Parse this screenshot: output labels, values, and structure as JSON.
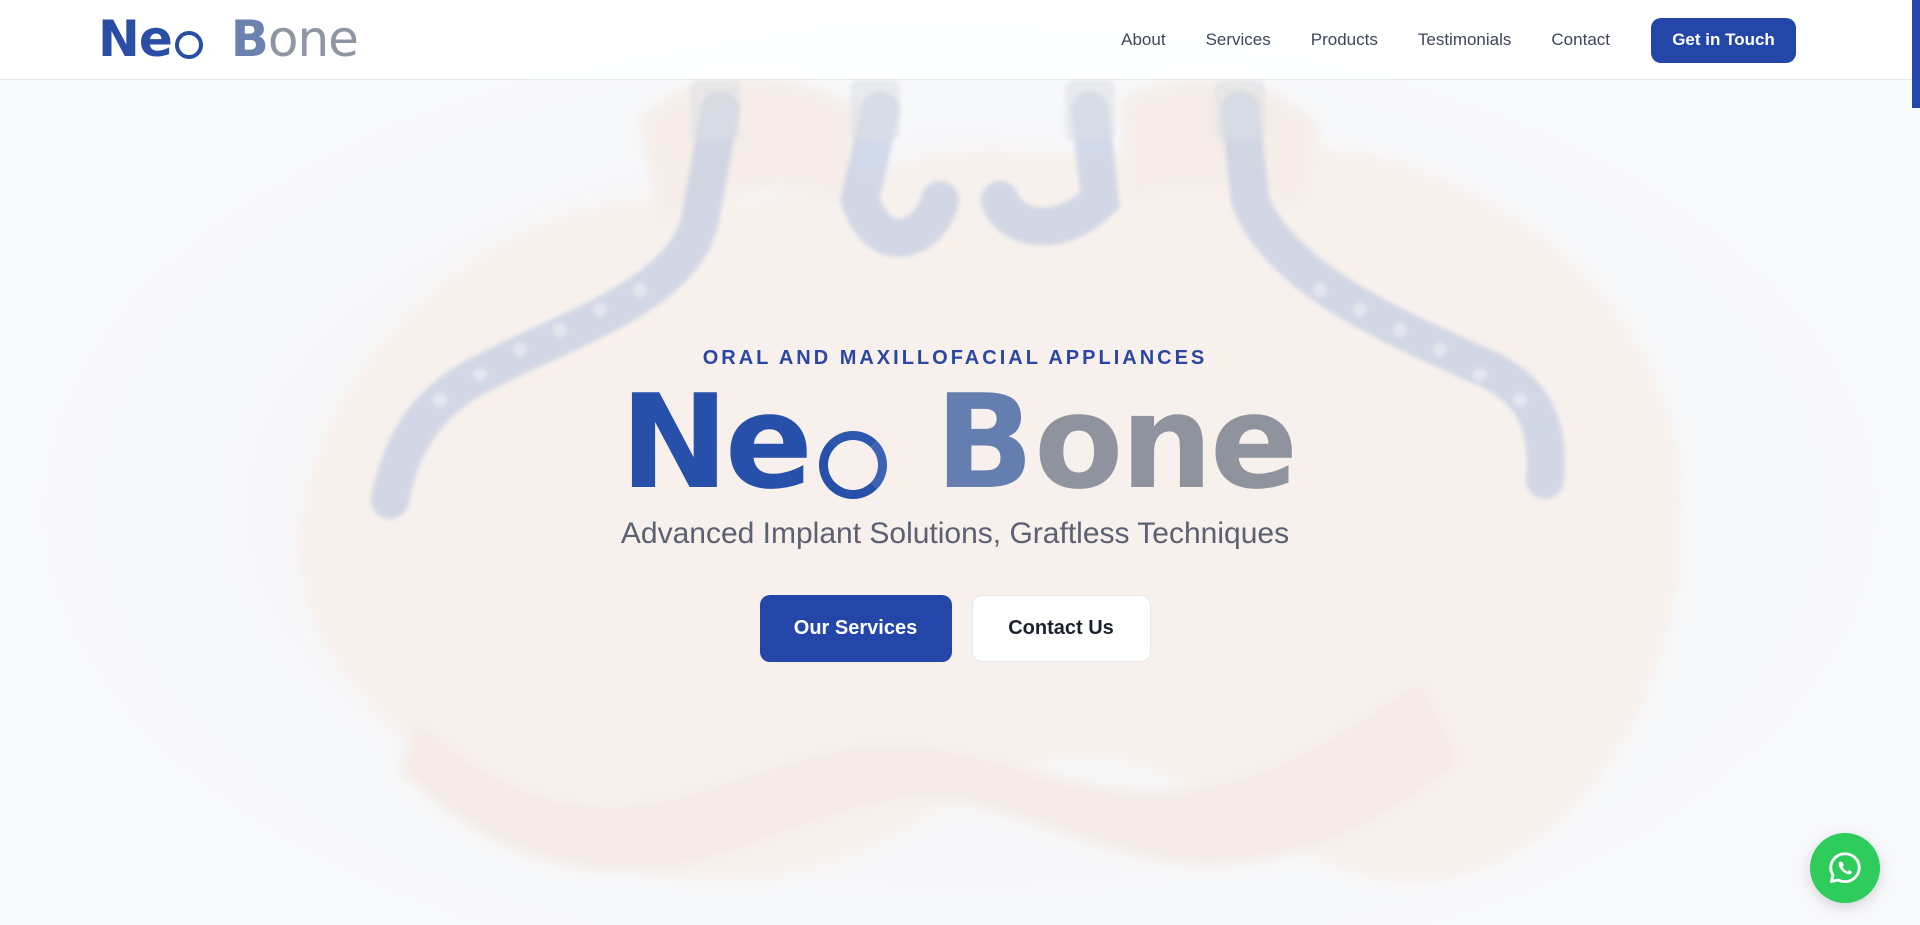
{
  "brand": {
    "logo_ne": "Ne",
    "logo_b": "B",
    "logo_one": "one",
    "primary_color": "#2346a8",
    "secondary_color": "#6a82ad",
    "gray_color": "#8f95a3"
  },
  "nav": {
    "items": [
      {
        "label": "About"
      },
      {
        "label": "Services"
      },
      {
        "label": "Products"
      },
      {
        "label": "Testimonials"
      },
      {
        "label": "Contact"
      }
    ],
    "cta_label": "Get in Touch"
  },
  "hero": {
    "eyebrow": "ORAL AND MAXILLOFACIAL APPLIANCES",
    "logo_ne": "Ne",
    "logo_b": "B",
    "logo_one": "one",
    "tagline": "Advanced Implant Solutions, Graftless Techniques",
    "primary_button": "Our Services",
    "secondary_button": "Contact Us"
  },
  "floating": {
    "icon": "whatsapp-icon",
    "color": "#2ecc5b"
  }
}
